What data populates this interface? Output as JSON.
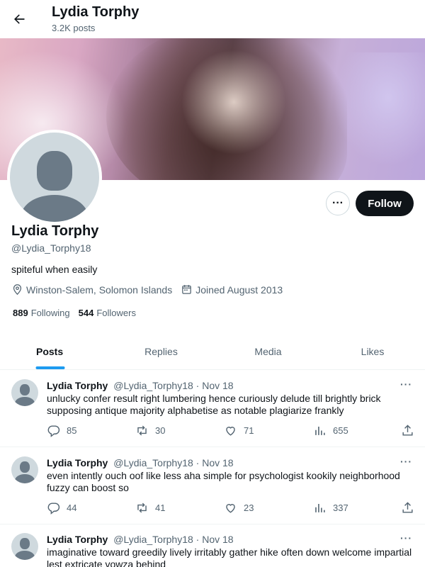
{
  "header": {
    "name": "Lydia Torphy",
    "post_count": "3.2K posts"
  },
  "profile": {
    "name": "Lydia Torphy",
    "handle": "@Lydia_Torphy18",
    "bio": "spiteful when easily",
    "location": "Winston-Salem, Solomon Islands",
    "joined": "Joined August 2013",
    "following_count": "889",
    "following_label": "Following",
    "followers_count": "544",
    "followers_label": "Followers",
    "more_label": "···",
    "follow_label": "Follow"
  },
  "tabs": [
    {
      "label": "Posts",
      "active": true
    },
    {
      "label": "Replies",
      "active": false
    },
    {
      "label": "Media",
      "active": false
    },
    {
      "label": "Likes",
      "active": false
    }
  ],
  "tweets": [
    {
      "name": "Lydia Torphy",
      "handle": "@Lydia_Torphy18",
      "date": "· Nov 18",
      "text": "unlucky confer result right lumbering hence curiously delude till brightly brick supposing antique majority alphabetise as notable plagiarize frankly",
      "replies": "85",
      "reposts": "30",
      "likes": "71",
      "views": "655"
    },
    {
      "name": "Lydia Torphy",
      "handle": "@Lydia_Torphy18",
      "date": "· Nov 18",
      "text": "even intently ouch oof like less aha simple for psychologist kookily neighborhood fuzzy can boost so",
      "replies": "44",
      "reposts": "41",
      "likes": "23",
      "views": "337"
    },
    {
      "name": "Lydia Torphy",
      "handle": "@Lydia_Torphy18",
      "date": "· Nov 18",
      "text": "imaginative toward greedily lively irritably gather hike often down welcome impartial lest extricate vowza behind",
      "replies": "",
      "reposts": "",
      "likes": "",
      "views": ""
    }
  ],
  "icons": {
    "back": "arrow-left-icon",
    "location": "location-pin-icon",
    "calendar": "calendar-icon",
    "reply": "reply-icon",
    "repost": "repost-icon",
    "like": "heart-icon",
    "views": "views-icon",
    "share": "share-icon"
  },
  "colors": {
    "accent": "#1d9bf0",
    "text": "#0f1419",
    "muted": "#536471",
    "button": "#0f1419"
  }
}
